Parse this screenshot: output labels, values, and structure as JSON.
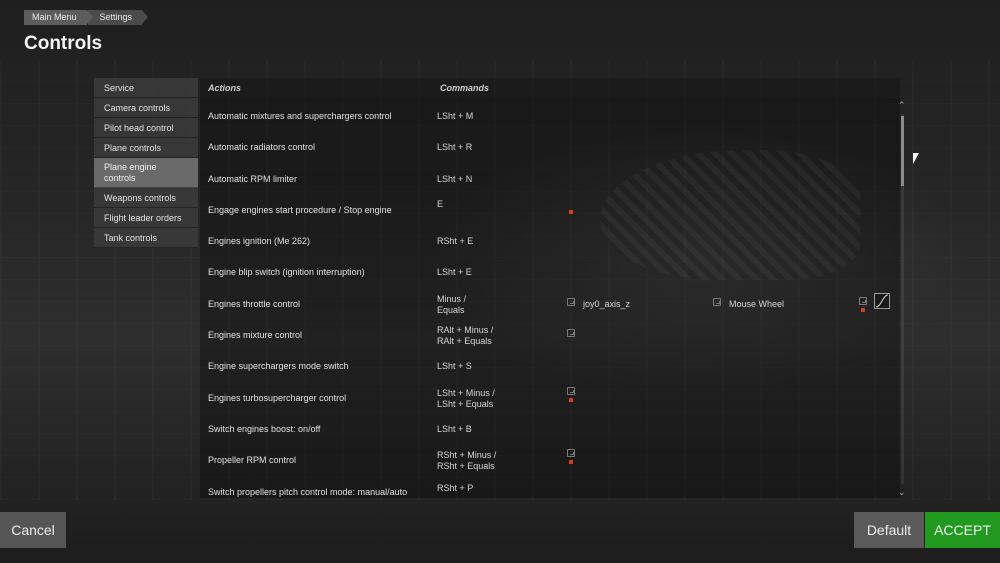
{
  "breadcrumb": [
    "Main Menu",
    "Settings"
  ],
  "page_title": "Controls",
  "categories": [
    {
      "label": "Service",
      "active": false
    },
    {
      "label": "Camera controls",
      "active": false
    },
    {
      "label": "Pilot head control",
      "active": false
    },
    {
      "label": "Plane controls",
      "active": false
    },
    {
      "label": "Plane engine controls",
      "active": true
    },
    {
      "label": "Weapons controls",
      "active": false
    },
    {
      "label": "Flight leader orders",
      "active": false
    },
    {
      "label": "Tank controls",
      "active": false
    }
  ],
  "table": {
    "headers": {
      "actions": "Actions",
      "commands": "Commands"
    },
    "rows": [
      {
        "action": "Automatic mixtures and superchargers control",
        "command": "LSht + M"
      },
      {
        "action": "Automatic radiators control",
        "command": "LSht + R"
      },
      {
        "action": "Automatic RPM limiter",
        "command": "LSht + N"
      },
      {
        "action": "Engage engines start procedure / Stop engine",
        "command": "E"
      },
      {
        "action": "Engines ignition (Me 262)",
        "command": "RSht + E"
      },
      {
        "action": "Engine blip switch (ignition interruption)",
        "command": "LSht + E"
      },
      {
        "action": "Engines throttle control",
        "command": "Minus / Equals",
        "device1": "joy0_axis_z",
        "device2": "Mouse Wheel"
      },
      {
        "action": "Engines mixture control",
        "command": "RAlt + Minus / RAlt + Equals"
      },
      {
        "action": "Engine superchargers mode switch",
        "command": "LSht + S"
      },
      {
        "action": "Engines turbosupercharger control",
        "command": "LSht + Minus / LSht + Equals"
      },
      {
        "action": "Switch engines boost: on/off",
        "command": "LSht + B"
      },
      {
        "action": "Propeller RPM control",
        "command": "RSht + Minus / RSht + Equals"
      },
      {
        "action": "Switch propellers pitch control mode: manual/auto",
        "command": "RSht + P"
      }
    ]
  },
  "command_lines": {
    "r6a": "Minus /",
    "r6b": "Equals",
    "r7a": "RAlt + Minus /",
    "r7b": "RAlt + Equals",
    "r9a": "LSht + Minus /",
    "r9b": "LSht + Equals",
    "r11a": "RSht + Minus /",
    "r11b": "RSht + Equals"
  },
  "buttons": {
    "cancel": "Cancel",
    "default": "Default",
    "accept": "ACCEPT"
  },
  "colors": {
    "accept": "#229a1f",
    "active_category": "#6a6a6a",
    "binding_alert": "#d2411f"
  },
  "icons": [
    "gamepad-icon",
    "red-alert-icon",
    "axis-curve-icon",
    "scroll-up-icon",
    "scroll-down-icon",
    "mouse-cursor-icon"
  ]
}
